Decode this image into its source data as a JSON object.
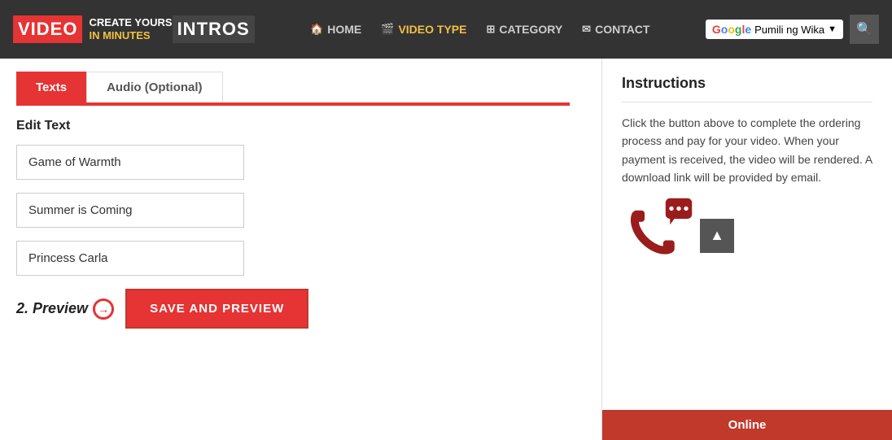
{
  "header": {
    "logo_video": "VIDEO",
    "logo_intros": "INTROS",
    "logo_create_line1": "CREATE YOURS",
    "logo_create_line2_normal": "IN ",
    "logo_create_line2_accent": "MINUTES",
    "nav": [
      {
        "label": "HOME",
        "icon": "🏠",
        "active": false
      },
      {
        "label": "VIDEO TYPE",
        "icon": "🎬",
        "active": true
      },
      {
        "label": "CATEGORY",
        "icon": "⊞",
        "active": false
      },
      {
        "label": "CONTACT",
        "icon": "✉",
        "active": false
      }
    ],
    "translate_text": "Pumili ng Wika",
    "search_icon": "🔍"
  },
  "left_panel": {
    "tabs": [
      {
        "label": "Texts",
        "active": true
      },
      {
        "label": "Audio (Optional)",
        "active": false
      }
    ],
    "edit_text_label": "Edit Text",
    "text_fields": [
      {
        "value": "Game of Warmth"
      },
      {
        "value": "Summer is Coming"
      },
      {
        "value": "Princess Carla"
      }
    ],
    "preview_label": "2. Preview",
    "save_button_label": "SAVE AND PREVIEW"
  },
  "right_panel": {
    "instructions_title": "Instructions",
    "instructions_text": "Click the button above to complete the ordering process and pay for your video. When your payment is received, the video will be rendered. A download link will be provided by email.",
    "online_label": "Online"
  }
}
